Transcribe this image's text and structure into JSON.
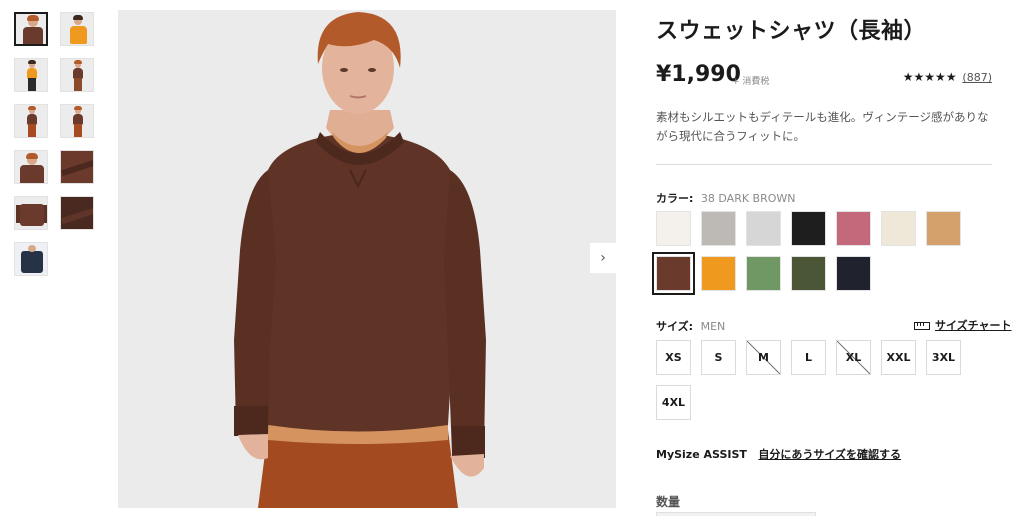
{
  "product": {
    "title": "スウェットシャツ（長袖）",
    "price": "¥1,990",
    "tax_note": "+ 消費税",
    "rating_stars": "★★★★★",
    "rating_count": "(887)",
    "description": "素材もシルエットもディテールも進化。ヴィンテージ感がありながら現代に合うフィットに。"
  },
  "color": {
    "label": "カラー:",
    "selected_value": "38 DARK BROWN",
    "swatches": [
      {
        "name": "off-white",
        "hex": "#f4f1ec"
      },
      {
        "name": "heather-gray",
        "hex": "#bdb9b5"
      },
      {
        "name": "light-gray",
        "hex": "#d6d6d6"
      },
      {
        "name": "black",
        "hex": "#1f1e1f"
      },
      {
        "name": "pink",
        "hex": "#c4687c"
      },
      {
        "name": "natural",
        "hex": "#efe7d7"
      },
      {
        "name": "camel",
        "hex": "#d4a06c"
      },
      {
        "name": "dark-brown",
        "hex": "#6a3a2d",
        "selected": true
      },
      {
        "name": "orange",
        "hex": "#ef9a1e"
      },
      {
        "name": "green",
        "hex": "#6f9864"
      },
      {
        "name": "olive",
        "hex": "#4b5637"
      },
      {
        "name": "navy",
        "hex": "#20222d"
      }
    ]
  },
  "size": {
    "label": "サイズ:",
    "category": "MEN",
    "chart_link": "サイズチャート",
    "options": [
      {
        "label": "XS",
        "available": true
      },
      {
        "label": "S",
        "available": true
      },
      {
        "label": "M",
        "available": false
      },
      {
        "label": "L",
        "available": true
      },
      {
        "label": "XL",
        "available": false
      },
      {
        "label": "XXL",
        "available": true
      },
      {
        "label": "3XL",
        "available": true
      },
      {
        "label": "4XL",
        "available": true
      }
    ]
  },
  "mysize": {
    "label": "MySize ASSIST",
    "link": "自分にあうサイズを確認する"
  },
  "quantity": {
    "label": "数量"
  },
  "gallery": {
    "next_arrow": "›",
    "thumbnail_count": 11
  }
}
